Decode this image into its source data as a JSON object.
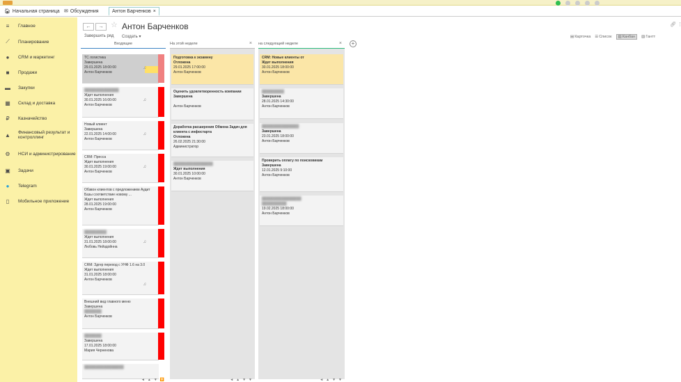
{
  "tabs": {
    "home": "Начальная страница",
    "discussions": "Обсуждения",
    "active": "Антон Барченков"
  },
  "sidebar": {
    "items": [
      {
        "label": "Главное",
        "icon": "menu-icon"
      },
      {
        "label": "Планирование",
        "icon": "chart-icon"
      },
      {
        "label": "CRM и маркетинг",
        "icon": "crm-icon"
      },
      {
        "label": "Продажи",
        "icon": "bag-icon"
      },
      {
        "label": "Закупки",
        "icon": "cart-icon"
      },
      {
        "label": "Склад и доставка",
        "icon": "warehouse-icon"
      },
      {
        "label": "Казначейство",
        "icon": "treasury-icon"
      },
      {
        "label": "Финансовый результат и контроллинг",
        "icon": "finance-icon"
      },
      {
        "label": "НСИ и администрирование",
        "icon": "gear-icon"
      },
      {
        "label": "Задачи",
        "icon": "tasks-icon"
      },
      {
        "label": "Telegram",
        "icon": "telegram-icon"
      },
      {
        "label": "Мобильное приложение",
        "icon": "mobile-icon"
      }
    ]
  },
  "header": {
    "title": "Антон Барченков",
    "back": "←",
    "forward": "→",
    "complete_step": "Завершить ряд",
    "create": "Создать ▾",
    "views": {
      "card": "Карточка",
      "list": "Список",
      "kanban": "Канбан",
      "gantt": "Гантт"
    }
  },
  "columns": [
    {
      "title": "Входящие",
      "cards": [
        {
          "title": "ТС логистика",
          "status": "Завершена",
          "date": "29.01.2025 18:00:00",
          "user": "Антон Барченков"
        },
        {
          "title": "",
          "status": "Ждет выполнения",
          "date": "30.01.2025 16:00:00",
          "user": "Антон Барченков"
        },
        {
          "title": "Новый клиент",
          "status": "Завершена",
          "date": "22.01.2025 14:00:00",
          "user": "Антон Барченков"
        },
        {
          "title": "CRM: Пресса",
          "status": "Ждет выполнения",
          "date": "30.01.2025 19:00:00",
          "user": "Антон Барченков"
        },
        {
          "title": "Обзвон клиентов с предложением Аудит Базы соответствие новому ...",
          "status": "Ждет выполнения",
          "date": "28.01.2025 19:00:00",
          "user": "Антон Барченков"
        },
        {
          "title": "",
          "status": "Ждет выполнения",
          "date": "31.01.2025 18:00:00",
          "user": "Любовь Нейздойнна"
        },
        {
          "title": "CRM: Здгер переход с УНФ 1.6 на 3.0",
          "status": "Ждет выполнения",
          "date": "31.01.2025 18:00:00",
          "user": "Антон Барченков"
        },
        {
          "title": "Внешний вид главного меню",
          "status": "Завершена",
          "date": "",
          "user": "Антон Барченков"
        },
        {
          "title": "",
          "status": "Завершена",
          "date": "17.01.2025 18:00:00",
          "user": "Мария Черненова"
        }
      ]
    },
    {
      "title": "На этой неделе",
      "cards": [
        {
          "title": "Подготовка к экзамену",
          "status": "Отложена",
          "date": "29.01.2025 17:00:00",
          "user": "Антон Барченков"
        },
        {
          "title": "Оценить удовлетворенность компании",
          "status": "Завершена",
          "date": "",
          "user": "Антон Барченков"
        },
        {
          "title": "Доработка расширения Обмена Задач для клиента с инфостарта",
          "status": "Отложена",
          "date": "26.02.2025 21:30:00",
          "user": "Администратор"
        },
        {
          "title": "",
          "status": "Ждет выполнения",
          "date": "30.01.2025 10:00:00",
          "user": "Антон Барченков"
        }
      ]
    },
    {
      "title": "на следующей неделе",
      "cards": [
        {
          "title": "CRM: Новые клиенты от",
          "status": "Ждет выполнения",
          "date": "30.01.2025 18:00:00",
          "user": "Антон Барченков"
        },
        {
          "title": "",
          "status": "Завершена",
          "date": "28.01.2025 14:30:00",
          "user": "Антон Барченков"
        },
        {
          "title": "",
          "status": "Завершена",
          "date": "23.01.2025 18:00:00",
          "user": "Антон Барченков"
        },
        {
          "title": "Проверить оплату по поисковикам",
          "status": "Завершена",
          "date": "12.01.2025 9:10:00",
          "user": "Антон Барченков"
        },
        {
          "title": "",
          "status": "",
          "date": "19.02.2025 18:00:00",
          "user": "Антон Барченков"
        }
      ]
    }
  ]
}
